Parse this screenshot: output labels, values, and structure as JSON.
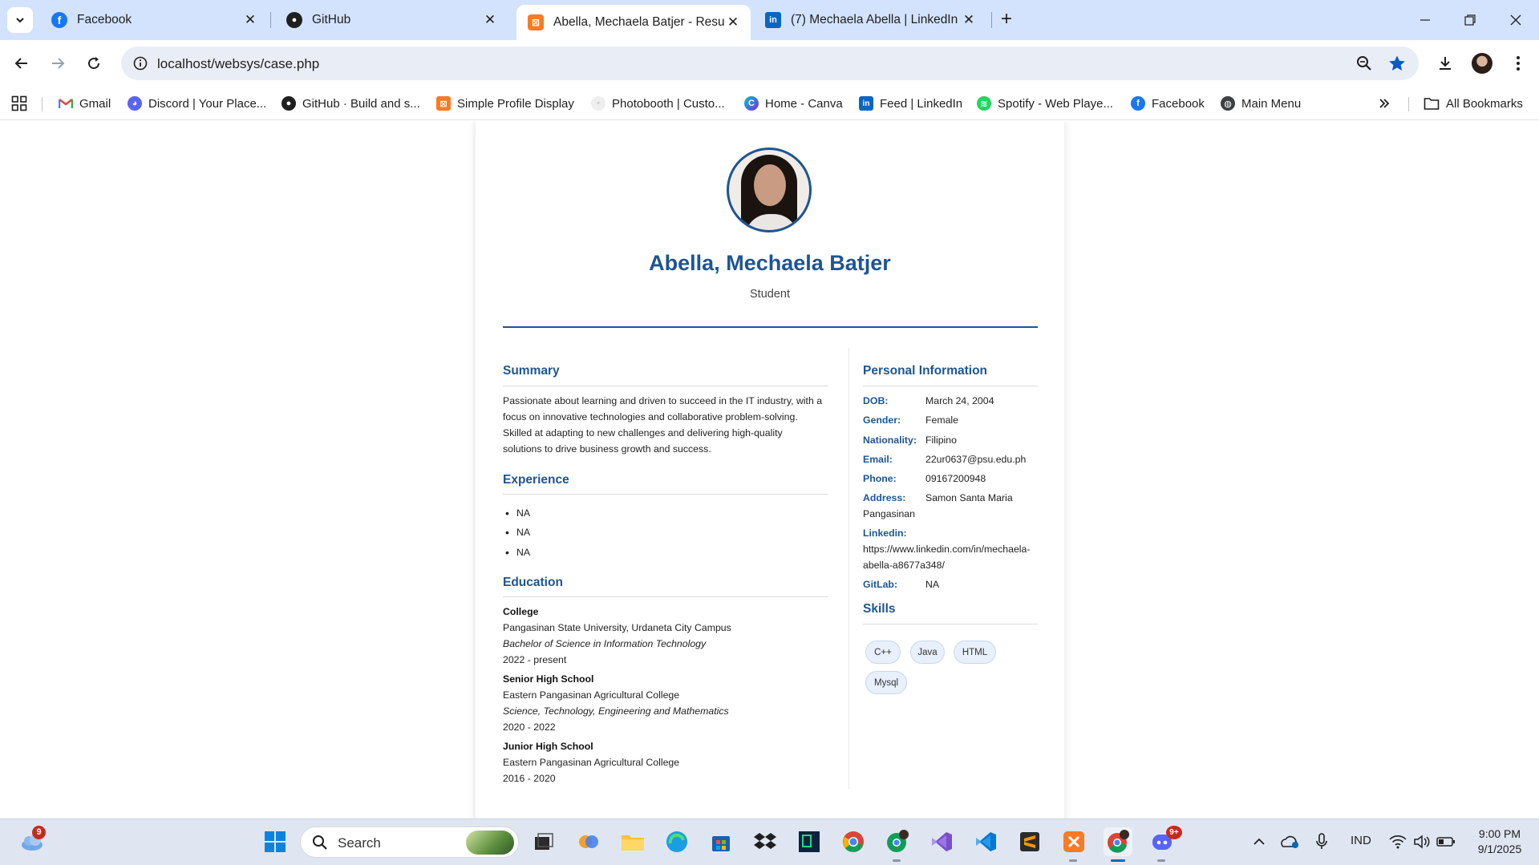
{
  "browser": {
    "tabs": [
      {
        "title": "Facebook",
        "icon": "facebook-icon",
        "active": false
      },
      {
        "title": "GitHub",
        "icon": "github-icon",
        "active": false
      },
      {
        "title": "Abella, Mechaela Batjer - Resum",
        "icon": "xampp-icon",
        "active": true
      },
      {
        "title": "(7) Mechaela Abella | LinkedIn",
        "icon": "linkedin-icon",
        "active": false
      }
    ],
    "new_tab_label": "+",
    "url": "localhost/websys/case.php",
    "bookmarks": [
      {
        "label": "Gmail",
        "icon": "gmail-icon"
      },
      {
        "label": "Discord | Your Place...",
        "icon": "discord-icon"
      },
      {
        "label": "GitHub · Build and s...",
        "icon": "github-icon"
      },
      {
        "label": "Simple Profile Display",
        "icon": "xampp-icon"
      },
      {
        "label": "Photobooth | Custo...",
        "icon": "photobooth-icon"
      },
      {
        "label": "Home - Canva",
        "icon": "canva-icon"
      },
      {
        "label": "Feed | LinkedIn",
        "icon": "linkedin-icon"
      },
      {
        "label": "Spotify - Web Playe...",
        "icon": "spotify-icon"
      },
      {
        "label": "Facebook",
        "icon": "facebook-icon"
      },
      {
        "label": "Main Menu",
        "icon": "globe-icon"
      }
    ],
    "all_bookmarks_label": "All Bookmarks"
  },
  "resume": {
    "name": "Abella, Mechaela Batjer",
    "role": "Student",
    "summary_title": "Summary",
    "summary_lines": [
      "Passionate about learning and driven to succeed in the IT industry, with a",
      "focus on innovative technologies and collaborative problem-solving.",
      "Skilled at adapting to new challenges and delivering high-quality",
      "solutions to drive business growth and success."
    ],
    "experience_title": "Experience",
    "experience": [
      "NA",
      "NA",
      "NA"
    ],
    "education_title": "Education",
    "education": [
      {
        "level": "College",
        "school": "Pangasinan State University, Urdaneta City Campus",
        "degree": "Bachelor of Science in Information Technology",
        "years": "2022 - present"
      },
      {
        "level": "Senior High School",
        "school": "Eastern Pangasinan Agricultural College",
        "degree": "Science, Technology, Engineering and Mathematics",
        "years": "2020 - 2022"
      },
      {
        "level": "Junior High School",
        "school": "Eastern Pangasinan Agricultural College",
        "years": "2016 - 2020"
      }
    ],
    "personal_title": "Personal Information",
    "personal": {
      "dob_label": "DOB:",
      "dob": "March 24, 2004",
      "gender_label": "Gender:",
      "gender": "Female",
      "nationality_label": "Nationality:",
      "nationality": "Filipino",
      "email_label": "Email:",
      "email": "22ur0637@psu.edu.ph",
      "phone_label": "Phone:",
      "phone": "09167200948",
      "address_label": "Address:",
      "address_1": "Samon Santa Maria",
      "address_2": "Pangasinan",
      "linkedin_label": "Linkedin:",
      "linkedin_1": "https://www.linkedin.com/in/mechaela-",
      "linkedin_2": "abella-a8677a348/",
      "gitlab_label": "GitLab:",
      "gitlab": "NA"
    },
    "skills_title": "Skills",
    "skills": [
      "C++",
      "Java",
      "HTML",
      "Mysql"
    ]
  },
  "taskbar": {
    "weather_badge": "9",
    "search_label": "Search",
    "discord_badge": "9+",
    "language": "IND",
    "time": "9:00 PM",
    "date": "9/1/2025"
  },
  "colors": {
    "accent": "#1e5592",
    "tabstrip": "#d3e3fd",
    "omnibox": "#e9eef6"
  }
}
